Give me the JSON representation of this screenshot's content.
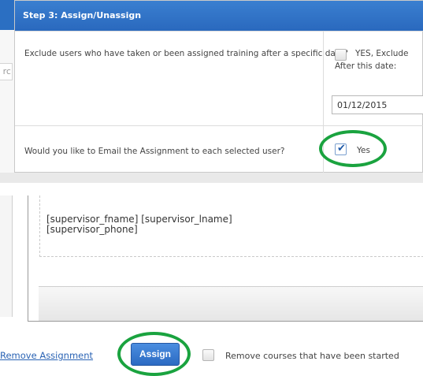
{
  "left_fragment": {
    "input_text": "rc"
  },
  "step_panel": {
    "header": "Step 3: Assign/Unassign",
    "exclude": {
      "question": "Exclude users who have taken or been assigned training after a specific date?",
      "checkbox_label": "YES, Exclude",
      "checked": false,
      "after_label": "After this date:",
      "date_value": "01/12/2015"
    },
    "email": {
      "question": "Would you like to Email the Assignment to each selected user?",
      "checkbox_label": "Yes",
      "checked": true
    }
  },
  "editor": {
    "line1": "[supervisor_fname] [supervisor_lname]",
    "line2": "[supervisor_phone]"
  },
  "actions": {
    "remove_assignment": "Remove Assignment",
    "assign": "Assign",
    "remove_started_label": "Remove courses that have been started",
    "remove_started_checked": false
  },
  "colors": {
    "header_blue": "#2a69be",
    "link_blue": "#2a63b4",
    "annotation_green": "#1aa33f"
  }
}
